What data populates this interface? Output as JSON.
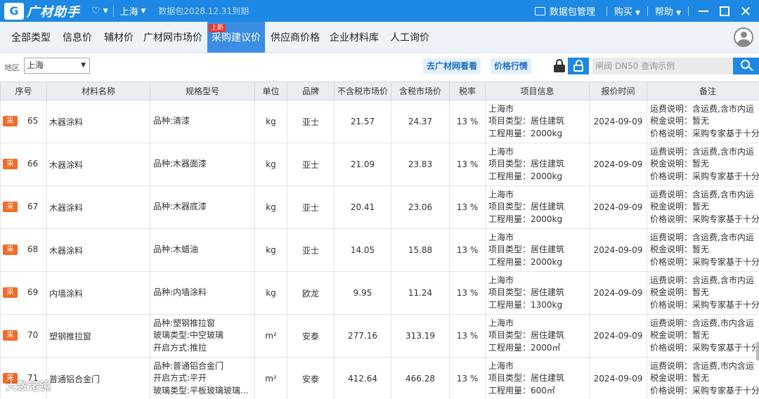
{
  "titlebar": {
    "logo_mark": "G",
    "app_name": "广材助手",
    "city": "上海",
    "expire_text": "数据包2028.12.31到期",
    "package_mgmt": "数据包管理",
    "buy": "购买",
    "help": "帮助"
  },
  "nav": {
    "tabs": [
      "全部类型",
      "信息价",
      "辅材价",
      "广材网市场价",
      "采购建议价",
      "供应商价格",
      "企业材料库",
      "人工询价"
    ],
    "active_index": 4,
    "new_badge": "上新"
  },
  "filter": {
    "region_label": "地区",
    "region_value": "上海",
    "link_go_site": "去广材网看看",
    "link_price_trend": "价格行情",
    "search_placeholder": "闸阀 DN50 查询示例"
  },
  "table": {
    "headers": [
      "序号",
      "材料名称",
      "规格型号",
      "单位",
      "品牌",
      "不含税市场价",
      "含税市场价",
      "税率",
      "项目信息",
      "报价时间",
      "备注"
    ],
    "badge": "采",
    "rows": [
      {
        "seq": "65",
        "name": "木器涂料",
        "spec": [
          "品种:清漆"
        ],
        "unit": "kg",
        "brand": "亚士",
        "price_ex": "21.57",
        "price_inc": "24.37",
        "tax": "13 %",
        "project": [
          "上海市",
          "项目类型：居住建筑",
          "工程用量：2000kg"
        ],
        "date": "2024-09-09",
        "remark": [
          "运费说明：含运费,含市内运",
          "税金说明：暂无",
          "价格说明：采购专家基于十分"
        ]
      },
      {
        "seq": "66",
        "name": "木器涂料",
        "spec": [
          "品种:木器面漆"
        ],
        "unit": "kg",
        "brand": "亚士",
        "price_ex": "21.09",
        "price_inc": "23.83",
        "tax": "13 %",
        "project": [
          "上海市",
          "项目类型：居住建筑",
          "工程用量：2000kg"
        ],
        "date": "2024-09-09",
        "remark": [
          "运费说明：含运费,含市内运",
          "税金说明：暂无",
          "价格说明：采购专家基于十分"
        ]
      },
      {
        "seq": "67",
        "name": "木器涂料",
        "spec": [
          "品种:木器底漆"
        ],
        "unit": "kg",
        "brand": "亚士",
        "price_ex": "20.41",
        "price_inc": "23.06",
        "tax": "13 %",
        "project": [
          "上海市",
          "项目类型：居住建筑",
          "工程用量：2000kg"
        ],
        "date": "2024-09-09",
        "remark": [
          "运费说明：含运费,含市内运",
          "税金说明：暂无",
          "价格说明：采购专家基于十分"
        ]
      },
      {
        "seq": "68",
        "name": "木器涂料",
        "spec": [
          "品种:木蜡油"
        ],
        "unit": "kg",
        "brand": "亚士",
        "price_ex": "14.05",
        "price_inc": "15.88",
        "tax": "13 %",
        "project": [
          "上海市",
          "项目类型：居住建筑",
          "工程用量：2000kg"
        ],
        "date": "2024-09-09",
        "remark": [
          "运费说明：含运费,含市内运",
          "税金说明：暂无",
          "价格说明：采购专家基于十分"
        ]
      },
      {
        "seq": "69",
        "name": "内墙涂料",
        "spec": [
          "品种:内墙涂料"
        ],
        "unit": "kg",
        "brand": "欧龙",
        "price_ex": "9.95",
        "price_inc": "11.24",
        "tax": "13 %",
        "project": [
          "上海市",
          "项目类型：居住建筑",
          "工程用量：1300kg"
        ],
        "date": "2024-09-09",
        "remark": [
          "运费说明：含运费,含市内运",
          "税金说明：暂无",
          "价格说明：采购专家基于十分"
        ]
      },
      {
        "seq": "70",
        "name": "塑钢推拉窗",
        "spec": [
          "品种:塑钢推拉窗",
          "玻璃类型:中空玻璃",
          "开启方式:推拉"
        ],
        "unit": "m²",
        "brand": "安泰",
        "price_ex": "277.16",
        "price_inc": "313.19",
        "tax": "13 %",
        "project": [
          "上海市",
          "项目类型：居住建筑",
          "工程用量：2000㎡"
        ],
        "date": "2024-09-09",
        "remark": [
          "运费说明：含运费,市内含运",
          "税金说明：暂无",
          "价格说明：采购专家基于十分"
        ]
      },
      {
        "seq": "71",
        "name": "普通铝合金门",
        "spec": [
          "品种:普通铝合金门",
          "开启方式:平开",
          "玻璃类型:平板玻璃玻璃..."
        ],
        "unit": "m²",
        "brand": "安泰",
        "price_ex": "412.64",
        "price_inc": "466.28",
        "tax": "13 %",
        "project": [
          "上海市",
          "项目类型：居住建筑",
          "工程用量：600㎡"
        ],
        "date": "2024-09-09",
        "remark": [
          "运费说明：含运费,市内含运",
          "税金说明：暂无",
          "价格说明：采购专家基于十分"
        ]
      }
    ]
  },
  "watermark": "大数诸镜"
}
